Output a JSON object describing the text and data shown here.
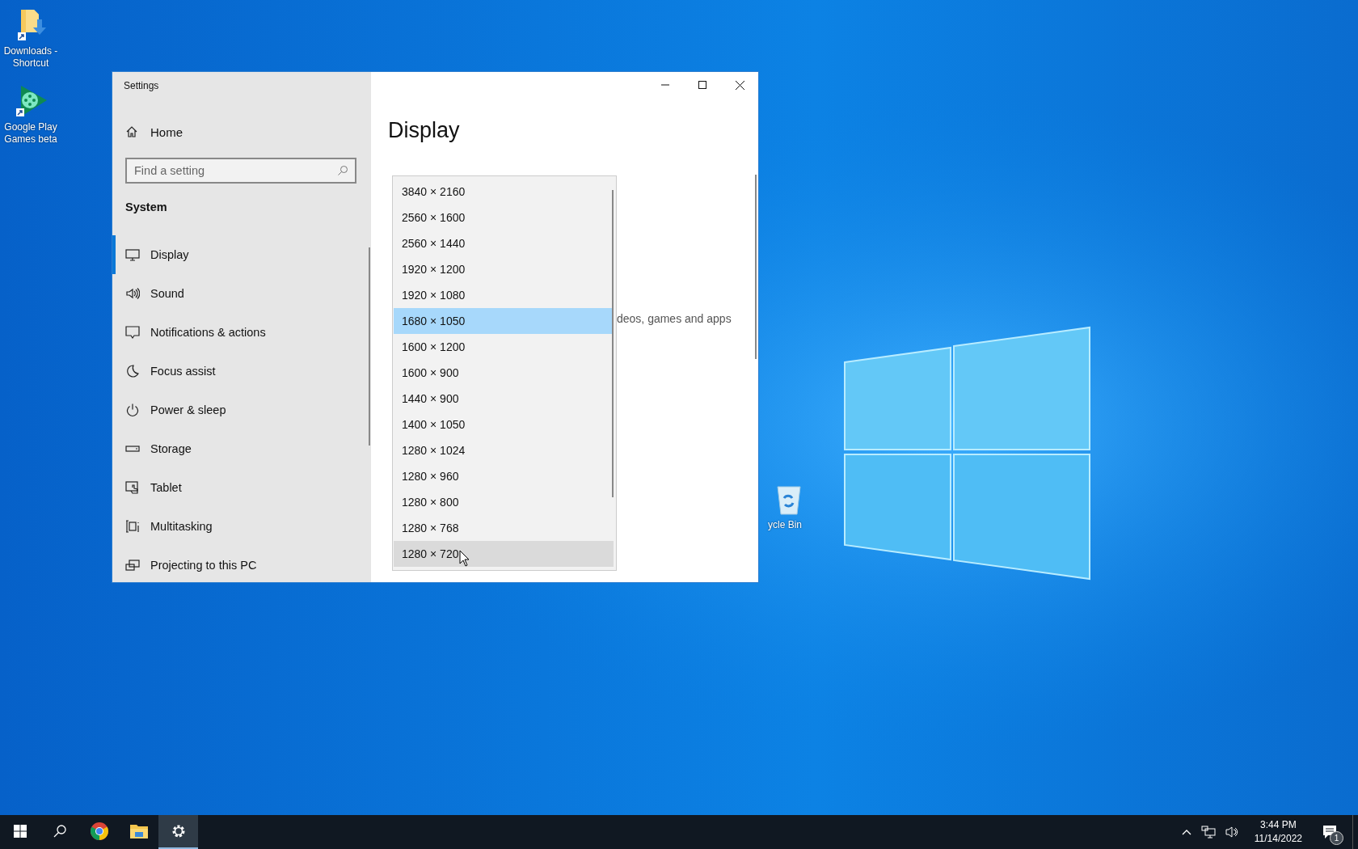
{
  "desktop": {
    "icons": [
      {
        "kind": "folder",
        "label": "Downloads - Shortcut"
      },
      {
        "kind": "game",
        "label": "Google Play Games beta"
      },
      {
        "kind": "recycle",
        "label": "ycle Bin"
      }
    ]
  },
  "window": {
    "title": "Settings",
    "sidebar": {
      "home": "Home",
      "search": {
        "placeholder": "Find a setting"
      },
      "section": "System",
      "items": [
        {
          "kind": "display",
          "label": "Display",
          "selected": true
        },
        {
          "kind": "sound",
          "label": "Sound",
          "selected": false
        },
        {
          "kind": "notifications",
          "label": "Notifications & actions",
          "selected": false
        },
        {
          "kind": "focus",
          "label": "Focus assist",
          "selected": false
        },
        {
          "kind": "power",
          "label": "Power & sleep",
          "selected": false
        },
        {
          "kind": "storage",
          "label": "Storage",
          "selected": false
        },
        {
          "kind": "tablet",
          "label": "Tablet",
          "selected": false
        },
        {
          "kind": "multitasking",
          "label": "Multitasking",
          "selected": false
        },
        {
          "kind": "projecting",
          "label": "Projecting to this PC",
          "selected": false
        }
      ]
    },
    "content": {
      "heading": "Display",
      "fragment": "deos, games and apps"
    },
    "dropdown": {
      "options": [
        {
          "label": "3840 × 2160",
          "selected": false,
          "hovered": false
        },
        {
          "label": "2560 × 1600",
          "selected": false,
          "hovered": false
        },
        {
          "label": "2560 × 1440",
          "selected": false,
          "hovered": false
        },
        {
          "label": "1920 × 1200",
          "selected": false,
          "hovered": false
        },
        {
          "label": "1920 × 1080",
          "selected": false,
          "hovered": false
        },
        {
          "label": "1680 × 1050",
          "selected": true,
          "hovered": false
        },
        {
          "label": "1600 × 1200",
          "selected": false,
          "hovered": false
        },
        {
          "label": "1600 × 900",
          "selected": false,
          "hovered": false
        },
        {
          "label": "1440 × 900",
          "selected": false,
          "hovered": false
        },
        {
          "label": "1400 × 1050",
          "selected": false,
          "hovered": false
        },
        {
          "label": "1280 × 1024",
          "selected": false,
          "hovered": false
        },
        {
          "label": "1280 × 960",
          "selected": false,
          "hovered": false
        },
        {
          "label": "1280 × 800",
          "selected": false,
          "hovered": false
        },
        {
          "label": "1280 × 768",
          "selected": false,
          "hovered": false
        },
        {
          "label": "1280 × 720",
          "selected": false,
          "hovered": true
        }
      ]
    }
  },
  "taskbar": {
    "apps": [
      {
        "kind": "start",
        "active": false
      },
      {
        "kind": "search",
        "active": false
      },
      {
        "kind": "chrome",
        "active": false
      },
      {
        "kind": "explorer",
        "active": false
      },
      {
        "kind": "settings",
        "active": true
      }
    ],
    "tray": {
      "time": "3:44 PM",
      "date": "11/14/2022",
      "notification_count": "1"
    }
  }
}
